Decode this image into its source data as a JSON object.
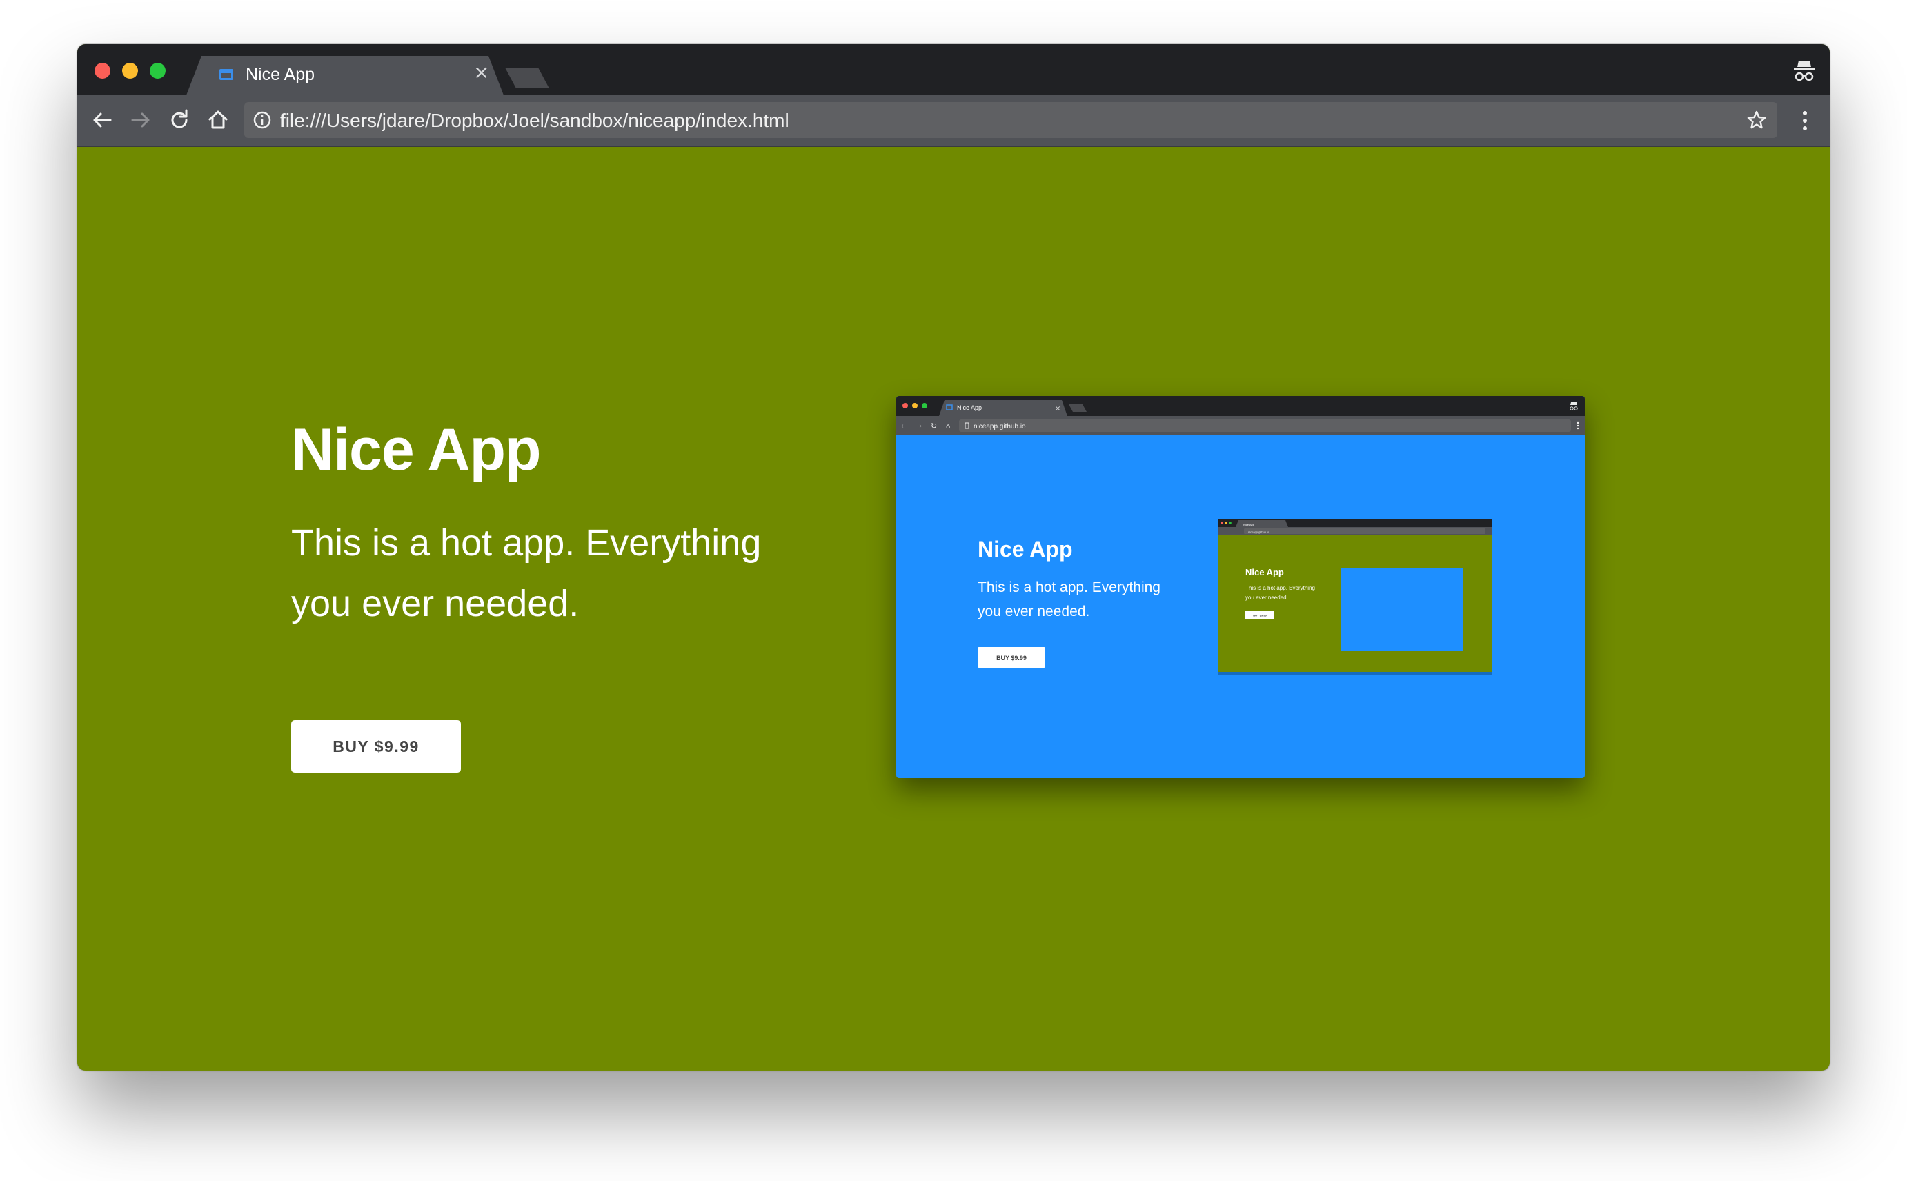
{
  "browser": {
    "tab_title": "Nice App",
    "tab_close": "×",
    "url": "file:///Users/jdare/Dropbox/Joel/sandbox/niceapp/index.html",
    "icons": {
      "tab": "window-icon",
      "close": "close-icon",
      "incognito": "incognito-icon",
      "back": "back-arrow-icon",
      "forward": "forward-arrow-icon",
      "reload": "reload-icon",
      "home": "home-icon",
      "info": "info-icon",
      "bookmark": "star-icon",
      "menu": "kebab-menu-icon"
    }
  },
  "page": {
    "title": "Nice App",
    "description": "This is a hot app. Everything you ever needed.",
    "buy_label": "BUY $9.99",
    "background_color": "#708a00"
  },
  "preview": {
    "url": "niceapp.github.io",
    "tab_title": "Nice App",
    "title": "Nice App",
    "description_line1": "This is a hot app. Everything",
    "description_line2": "you ever needed.",
    "buy_label": "BUY $9.99",
    "background_color": "#1e8fff",
    "nested": {
      "url": "niceapp.github.io",
      "tab_title": "Nice App",
      "title": "Nice App",
      "description_line1": "This is a hot app. Everything",
      "description_line2": "you ever needed.",
      "buy_label": "BUY $9.99",
      "background_color": "#708a00"
    }
  }
}
